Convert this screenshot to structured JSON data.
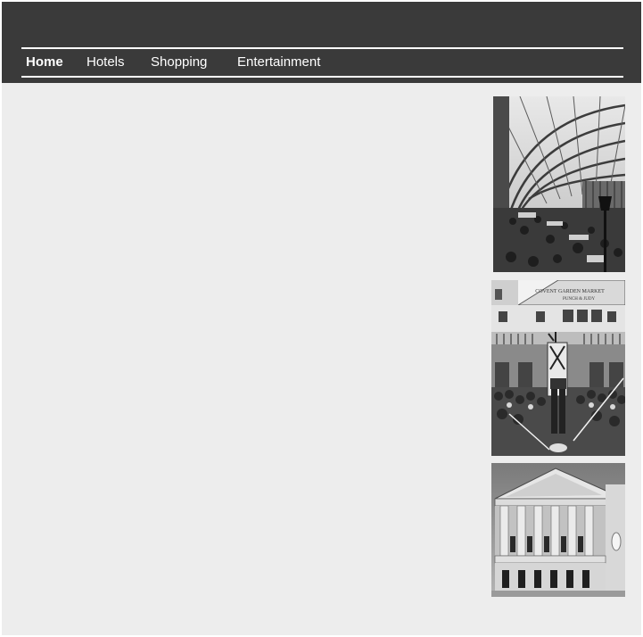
{
  "nav": {
    "items": [
      {
        "label": "Home",
        "active": true
      },
      {
        "label": "Hotels",
        "active": false
      },
      {
        "label": "Shopping",
        "active": false
      },
      {
        "label": "Entertainment",
        "active": false
      }
    ]
  },
  "sidebar": {
    "photos": [
      {
        "subject": "market-hall-photo"
      },
      {
        "subject": "street-performer-photo",
        "sign_text": "COVENT GARDEN MARKET",
        "sign_subtext": "PUNCH & JUDY"
      },
      {
        "subject": "opera-house-photo"
      }
    ]
  },
  "colors": {
    "header_bg": "#3a3a3a",
    "page_bg": "#ededed",
    "nav_text": "#ffffff"
  }
}
